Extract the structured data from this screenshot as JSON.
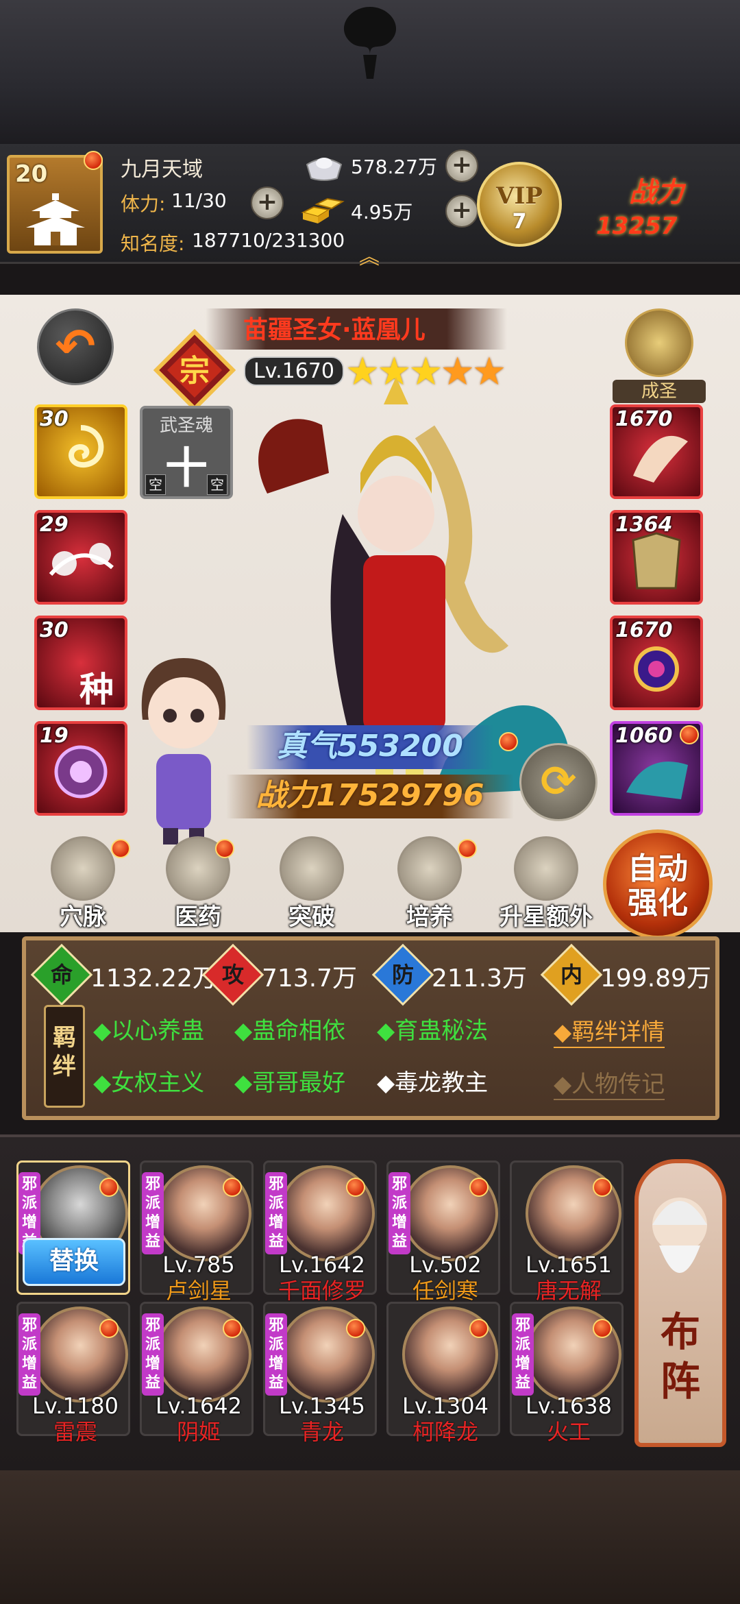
{
  "player": {
    "level": "20",
    "name": "九月天域",
    "stamina_label": "体力:",
    "stamina_value": "11/30",
    "fame_label": "知名度:",
    "fame_value": "187710/231300",
    "silver": "578.27万",
    "gold": "4.95万",
    "vip_text": "VIP",
    "vip_level": "7",
    "power_title": "战力",
    "power_value": "13257"
  },
  "hero": {
    "name": "苗疆圣女·蓝凰儿",
    "level": "Lv.1670",
    "stars_full": "★★★",
    "stars_half": "★★",
    "class_char": "宗",
    "sage_label": "成圣",
    "soul_title": "武圣魂",
    "soul_char": "十",
    "soul_empty": "空",
    "qi_text": "真气553200",
    "power_text": "战力17529796",
    "left_skills": [
      "30",
      "29",
      "30",
      "19"
    ],
    "skill_glyph": "种",
    "right_equipment": [
      "1670",
      "1364",
      "1670",
      "1060"
    ]
  },
  "actions": [
    {
      "label": "穴脉",
      "icon": "meridian-icon"
    },
    {
      "label": "医药",
      "icon": "medicine-icon"
    },
    {
      "label": "突破",
      "icon": "breakthrough-icon"
    },
    {
      "label": "培养",
      "icon": "cultivate-icon"
    },
    {
      "label": "升星额外",
      "icon": "star-up-icon"
    }
  ],
  "auto_btn": {
    "line1": "自动",
    "line2": "强化"
  },
  "stats": [
    {
      "badge": "命",
      "value": "1132.22万",
      "color": "#2aa02a"
    },
    {
      "badge": "攻",
      "value": "713.7万",
      "color": "#d82a2a"
    },
    {
      "badge": "防",
      "value": "211.3万",
      "color": "#2a78d8"
    },
    {
      "badge": "内",
      "value": "199.89万",
      "color": "#e0a020"
    }
  ],
  "bonds": {
    "seal": "羁绊",
    "row1": [
      "◆以心养蛊",
      "◆蛊命相依",
      "◆育蛊秘法"
    ],
    "row2_green": [
      "◆女权主义",
      "◆哥哥最好"
    ],
    "row2_white": "◆毒龙教主",
    "detail_link": "◆羁绊详情",
    "bio_link": "◆人物传记"
  },
  "formation": {
    "replace_label": "替换",
    "evil_tag": "邪派增益",
    "members_row1": [
      {
        "level": "Lv.785",
        "name": "卢剑星",
        "name_color": "orange"
      },
      {
        "level": "Lv.1642",
        "name": "千面修罗",
        "name_color": "red"
      },
      {
        "level": "Lv.502",
        "name": "任剑寒",
        "name_color": "orange"
      },
      {
        "level": "Lv.1651",
        "name": "唐无解",
        "name_color": "red"
      }
    ],
    "members_row2": [
      {
        "level": "Lv.1180",
        "name": "雷震",
        "name_color": "red"
      },
      {
        "level": "Lv.1642",
        "name": "阴姬",
        "name_color": "red"
      },
      {
        "level": "Lv.1345",
        "name": "青龙",
        "name_color": "red"
      },
      {
        "level": "Lv.1304",
        "name": "柯降龙",
        "name_color": "red"
      },
      {
        "level": "Lv.1638",
        "name": "火工",
        "name_color": "red"
      }
    ],
    "lineup_label_1": "布",
    "lineup_label_2": "阵"
  }
}
